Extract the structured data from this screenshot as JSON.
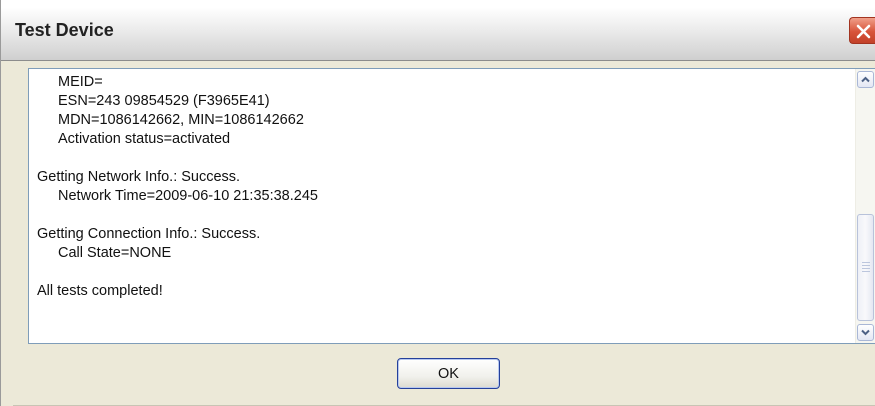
{
  "window": {
    "title": "Test Device",
    "close_icon": "close-icon"
  },
  "log": {
    "lines": [
      "MEID=",
      "ESN=243 09854529 (F3965E41)",
      "MDN=1086142662, MIN=1086142662",
      "Activation status=activated",
      "",
      "Getting Network Info.: Success.",
      "Network Time=2009-06-10 21:35:38.245",
      "",
      "Getting Connection Info.: Success.",
      "Call State=NONE",
      "",
      "All tests completed!"
    ]
  },
  "scrollbar": {
    "up_icon": "chevron-up-icon",
    "down_icon": "chevron-down-icon"
  },
  "buttons": {
    "ok_label": "OK"
  },
  "colors": {
    "close_button": "#d8543a",
    "ok_border": "#25409a",
    "dialog_background": "#ece9d8"
  }
}
